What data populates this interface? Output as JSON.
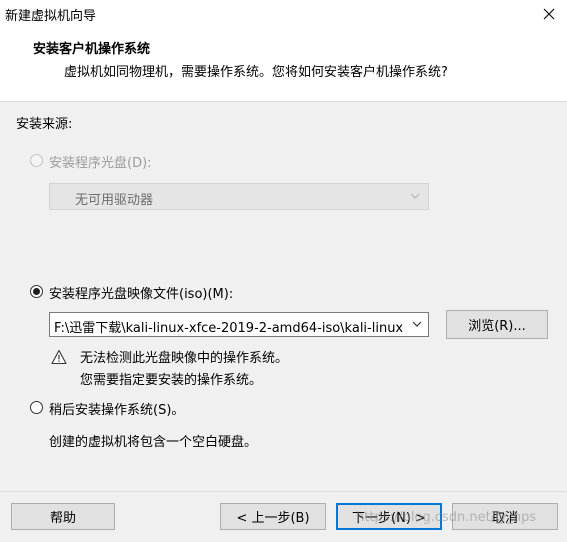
{
  "window": {
    "title": "新建虚拟机向导"
  },
  "header": {
    "title": "安装客户机操作系统",
    "subtitle": "虚拟机如同物理机，需要操作系统。您将如何安装客户机操作系统?"
  },
  "source": {
    "label": "安装来源:",
    "disc_option": {
      "label": "安装程序光盘(D):",
      "selected": false,
      "enabled": false
    },
    "disc_combo": {
      "value": "无可用驱动器",
      "enabled": false
    },
    "iso_option": {
      "label": "安装程序光盘映像文件(iso)(M):",
      "selected": true
    },
    "iso_path": {
      "value": "F:\\迅雷下载\\kali-linux-xfce-2019-2-amd64-iso\\kali-linux"
    },
    "browse_label": "浏览(R)...",
    "warning": {
      "line1": "无法检测此光盘映像中的操作系统。",
      "line2": "您需要指定要安装的操作系统。"
    },
    "later_option": {
      "label": "稍后安装操作系统(S)。",
      "selected": false
    },
    "later_desc": "创建的虚拟机将包含一个空白硬盘。"
  },
  "footer": {
    "help_label": "帮助",
    "back_label": "< 上一步(B)",
    "next_label": "下一步(N) >",
    "cancel_label": "取消",
    "watermark": "https://blog.csdn.net/ly_hps"
  }
}
